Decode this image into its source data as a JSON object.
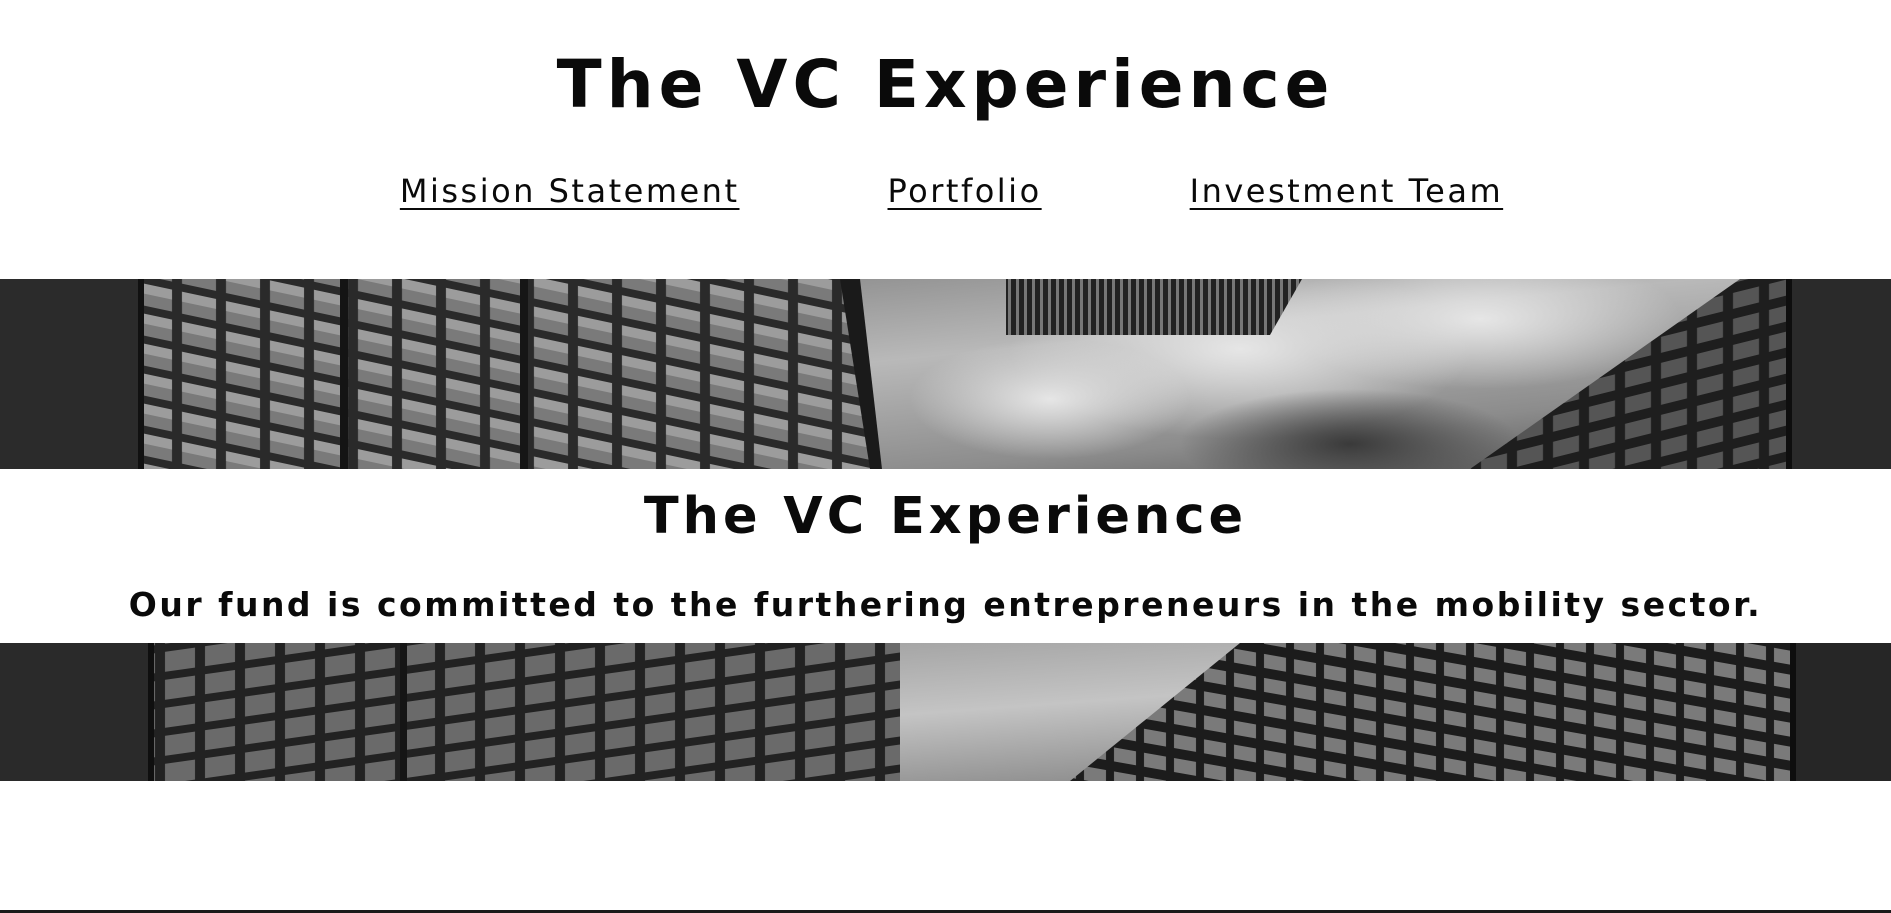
{
  "header": {
    "title": "The VC Experience"
  },
  "nav": {
    "items": [
      {
        "label": "Mission Statement"
      },
      {
        "label": "Portfolio"
      },
      {
        "label": "Investment Team"
      }
    ]
  },
  "hero": {
    "title": "The VC Experience",
    "subtitle": "Our fund is committed to the furthering entrepreneurs in the mobility sector."
  },
  "colors": {
    "background": "#ffffff",
    "text": "#0a0a0a",
    "photo_dark": "#1c1c1c",
    "photo_sky": "#9a9a9a"
  }
}
